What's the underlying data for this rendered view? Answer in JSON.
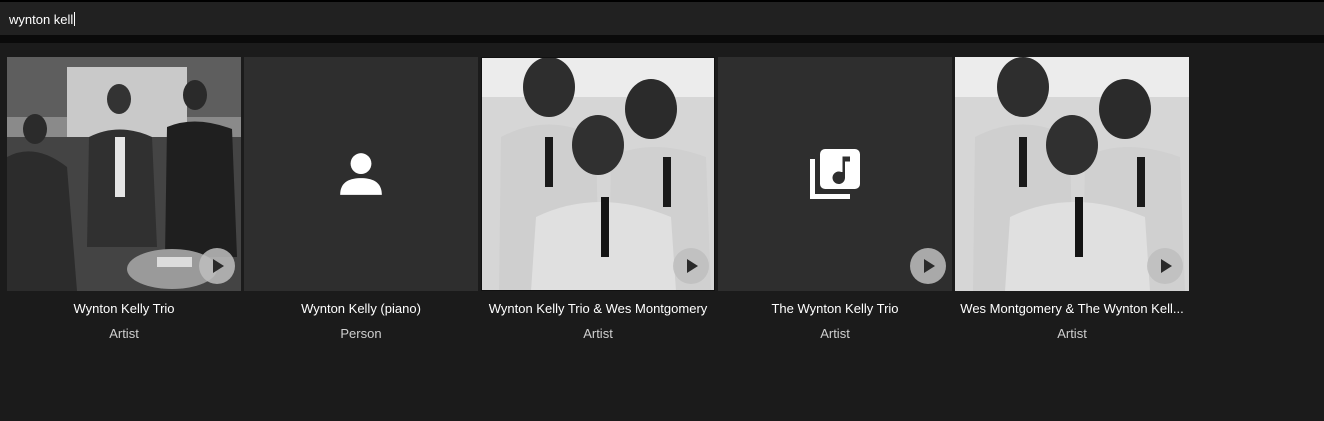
{
  "search": {
    "query": "wynton kell"
  },
  "results": [
    {
      "title": "Wynton Kelly Trio",
      "subtitle": "Artist",
      "thumb": "photo",
      "icon": "",
      "has_play": true
    },
    {
      "title": "Wynton Kelly (piano)",
      "subtitle": "Person",
      "thumb": "placeholder",
      "icon": "person-icon",
      "has_play": false
    },
    {
      "title": "Wynton Kelly Trio & Wes Montgomery",
      "subtitle": "Artist",
      "thumb": "photo",
      "icon": "",
      "has_play": true
    },
    {
      "title": "The Wynton Kelly Trio",
      "subtitle": "Artist",
      "thumb": "placeholder",
      "icon": "music-library-icon",
      "has_play": true
    },
    {
      "title": "Wes Montgomery & The Wynton Kell...",
      "subtitle": "Artist",
      "thumb": "photo",
      "icon": "",
      "has_play": true
    }
  ],
  "colors": {
    "background": "#1b1b1b",
    "search_bar": "#212121",
    "placeholder_tile": "#2e2e2e",
    "text_primary": "#ffffff",
    "text_secondary": "#cfcfcf"
  }
}
